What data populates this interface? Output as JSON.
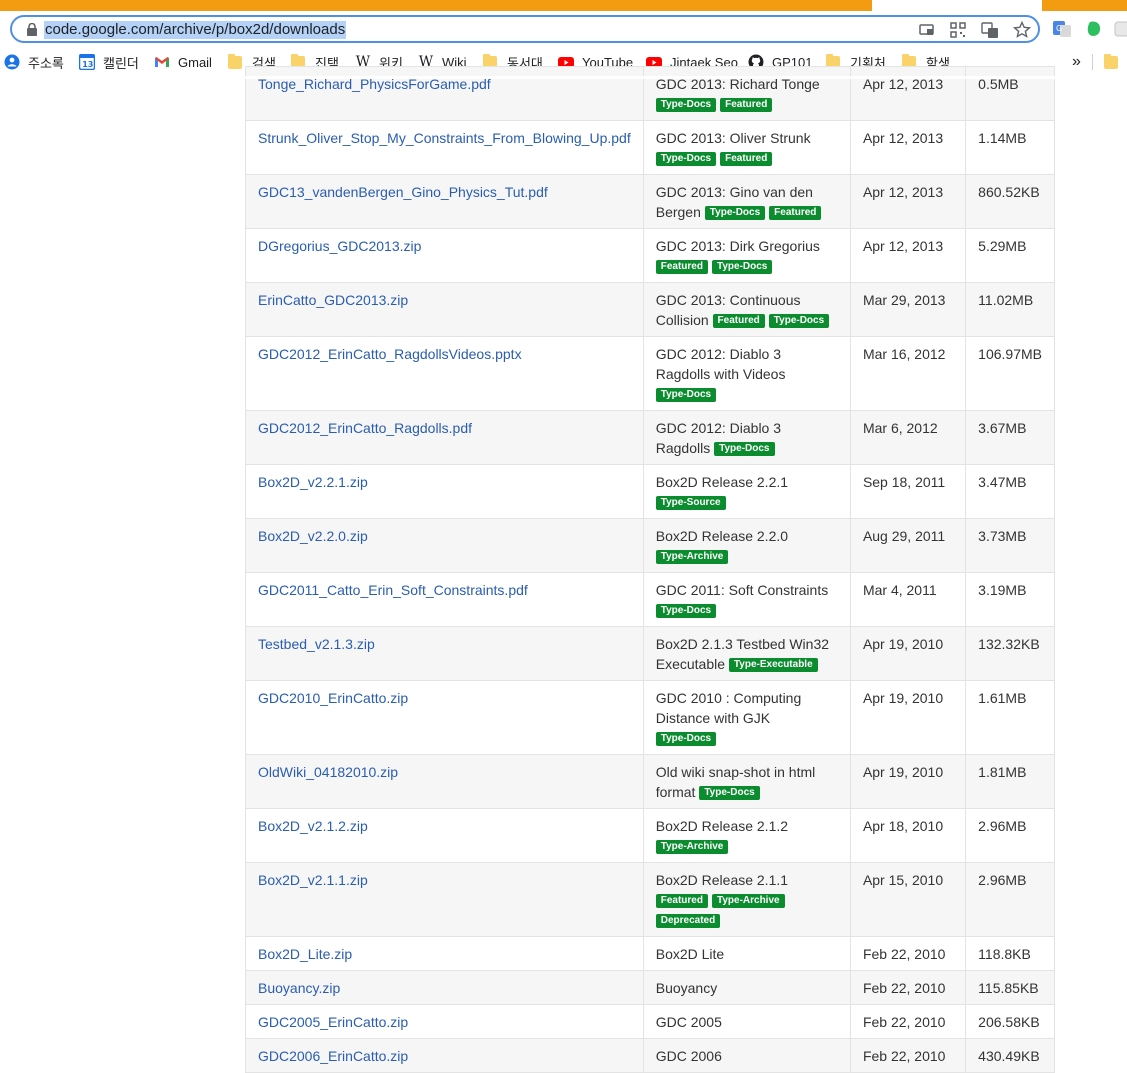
{
  "browser": {
    "url": "code.google.com/archive/p/box2d/downloads"
  },
  "bookmarks": [
    {
      "label": "주소록",
      "icon": "contacts-icon"
    },
    {
      "label": "캘린더",
      "icon": "calendar-icon"
    },
    {
      "label": "Gmail",
      "icon": "gmail-icon"
    },
    {
      "label": "검색",
      "icon": "folder-icon"
    },
    {
      "label": "진택",
      "icon": "folder-icon"
    },
    {
      "label": "위키",
      "icon": "wikipedia-icon"
    },
    {
      "label": "Wiki",
      "icon": "wikipedia-icon"
    },
    {
      "label": "동서대",
      "icon": "folder-icon"
    },
    {
      "label": "YouTube",
      "icon": "youtube-icon"
    },
    {
      "label": "Jintaek Seo",
      "icon": "youtube-icon"
    },
    {
      "label": "GP101",
      "icon": "github-icon"
    },
    {
      "label": "기획처",
      "icon": "folder-icon"
    },
    {
      "label": "학생",
      "icon": "folder-icon"
    }
  ],
  "bookmarks_overflow": "»",
  "calendar_day": "13",
  "downloads": [
    {
      "file": "Tonge_Richard_PhysicsForGame.pdf",
      "summary": "GDC 2013: Richard Tonge",
      "labels": [
        "Type-Docs",
        "Featured"
      ],
      "date": "Apr 12, 2013",
      "size": "0.5MB"
    },
    {
      "file": "Strunk_Oliver_Stop_My_Constraints_From_Blowing_Up.pdf",
      "summary": "GDC 2013: Oliver Strunk",
      "labels": [
        "Type-Docs",
        "Featured"
      ],
      "date": "Apr 12, 2013",
      "size": "1.14MB"
    },
    {
      "file": "GDC13_vandenBergen_Gino_Physics_Tut.pdf",
      "summary": "GDC 2013: Gino van den Bergen",
      "labels": [
        "Type-Docs",
        "Featured"
      ],
      "date": "Apr 12, 2013",
      "size": "860.52KB"
    },
    {
      "file": "DGregorius_GDC2013.zip",
      "summary": "GDC 2013: Dirk Gregorius",
      "labels": [
        "Featured",
        "Type-Docs"
      ],
      "date": "Apr 12, 2013",
      "size": "5.29MB"
    },
    {
      "file": "ErinCatto_GDC2013.zip",
      "summary": "GDC 2013: Continuous Collision",
      "labels": [
        "Featured",
        "Type-Docs"
      ],
      "date": "Mar 29, 2013",
      "size": "11.02MB"
    },
    {
      "file": "GDC2012_ErinCatto_RagdollsVideos.pptx",
      "summary": "GDC 2012: Diablo 3 Ragdolls with Videos",
      "labels": [
        "Type-Docs"
      ],
      "date": "Mar 16, 2012",
      "size": "106.97MB"
    },
    {
      "file": "GDC2012_ErinCatto_Ragdolls.pdf",
      "summary": "GDC 2012: Diablo 3 Ragdolls",
      "labels": [
        "Type-Docs"
      ],
      "date": "Mar 6, 2012",
      "size": "3.67MB"
    },
    {
      "file": "Box2D_v2.2.1.zip",
      "summary": "Box2D Release 2.2.1",
      "labels": [
        "Type-Source"
      ],
      "date": "Sep 18, 2011",
      "size": "3.47MB"
    },
    {
      "file": "Box2D_v2.2.0.zip",
      "summary": "Box2D Release 2.2.0",
      "labels": [
        "Type-Archive"
      ],
      "date": "Aug 29, 2011",
      "size": "3.73MB"
    },
    {
      "file": "GDC2011_Catto_Erin_Soft_Constraints.pdf",
      "summary": "GDC 2011: Soft Constraints",
      "labels": [
        "Type-Docs"
      ],
      "date": "Mar 4, 2011",
      "size": "3.19MB"
    },
    {
      "file": "Testbed_v2.1.3.zip",
      "summary": "Box2D 2.1.3 Testbed Win32 Executable",
      "labels": [
        "Type-Executable"
      ],
      "date": "Apr 19, 2010",
      "size": "132.32KB"
    },
    {
      "file": "GDC2010_ErinCatto.zip",
      "summary": "GDC 2010 : Computing Distance with GJK",
      "labels": [
        "Type-Docs"
      ],
      "date": "Apr 19, 2010",
      "size": "1.61MB"
    },
    {
      "file": "OldWiki_04182010.zip",
      "summary": "Old wiki snap-shot in html format",
      "labels": [
        "Type-Docs"
      ],
      "date": "Apr 19, 2010",
      "size": "1.81MB"
    },
    {
      "file": "Box2D_v2.1.2.zip",
      "summary": "Box2D Release 2.1.2",
      "labels": [
        "Type-Archive"
      ],
      "date": "Apr 18, 2010",
      "size": "2.96MB"
    },
    {
      "file": "Box2D_v2.1.1.zip",
      "summary": "Box2D Release 2.1.1",
      "labels": [
        "Featured",
        "Type-Archive",
        "Deprecated"
      ],
      "date": "Apr 15, 2010",
      "size": "2.96MB"
    },
    {
      "file": "Box2D_Lite.zip",
      "summary": "Box2D Lite",
      "labels": [],
      "date": "Feb 22, 2010",
      "size": "118.8KB"
    },
    {
      "file": "Buoyancy.zip",
      "summary": "Buoyancy",
      "labels": [],
      "date": "Feb 22, 2010",
      "size": "115.85KB"
    },
    {
      "file": "GDC2005_ErinCatto.zip",
      "summary": "GDC 2005",
      "labels": [],
      "date": "Feb 22, 2010",
      "size": "206.58KB"
    },
    {
      "file": "GDC2006_ErinCatto.zip",
      "summary": "GDC 2006",
      "labels": [],
      "date": "Feb 22, 2010",
      "size": "430.49KB"
    }
  ],
  "colors": {
    "tab_strip": "#f39c12",
    "omnibox_border": "#4f8fe6",
    "link": "#2a5db0",
    "badge": "#0b8c2f"
  }
}
